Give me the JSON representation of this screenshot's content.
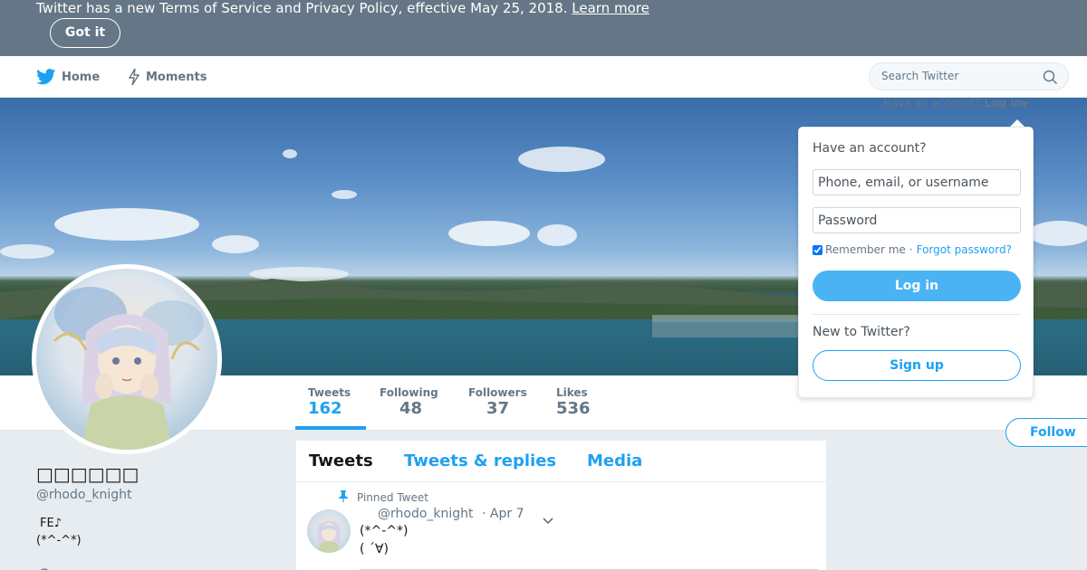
{
  "tos_banner": {
    "text": "Twitter has a new Terms of Service and Privacy Policy, effective May 25, 2018.",
    "link": "Learn more",
    "button": "Got it"
  },
  "nav": {
    "home": "Home",
    "moments": "Moments",
    "search_placeholder": "Search Twitter"
  },
  "stats": [
    {
      "label": "Tweets",
      "value": "162"
    },
    {
      "label": "Following",
      "value": "48"
    },
    {
      "label": "Followers",
      "value": "37"
    },
    {
      "label": "Likes",
      "value": "536"
    }
  ],
  "follow_button": "Follow",
  "profile": {
    "name": "□□□□□□",
    "handle": "@rhodo_knight",
    "bio_line1": "FE♪",
    "bio_line2": "(*^-^*)"
  },
  "timeline": {
    "tabs": [
      "Tweets",
      "Tweets & replies",
      "Media"
    ],
    "pinned_label": "Pinned Tweet",
    "tweet": {
      "handle": "@rhodo_knight",
      "date": "· Apr 7",
      "line1": "(*^-^*)",
      "line2": "( ´∀)"
    }
  },
  "login": {
    "toggle_prefix": "Have an account?",
    "toggle_link": "Log in",
    "title": "Have an account?",
    "username_placeholder": "Phone, email, or username",
    "password_placeholder": "Password",
    "remember": "Remember me",
    "separator": "·",
    "forgot": "Forgot password?",
    "login_button": "Log in",
    "new_to": "New to Twitter?",
    "signup_button": "Sign up"
  },
  "colors": {
    "brand": "#1da1f2",
    "banner_gray": "#657786"
  }
}
